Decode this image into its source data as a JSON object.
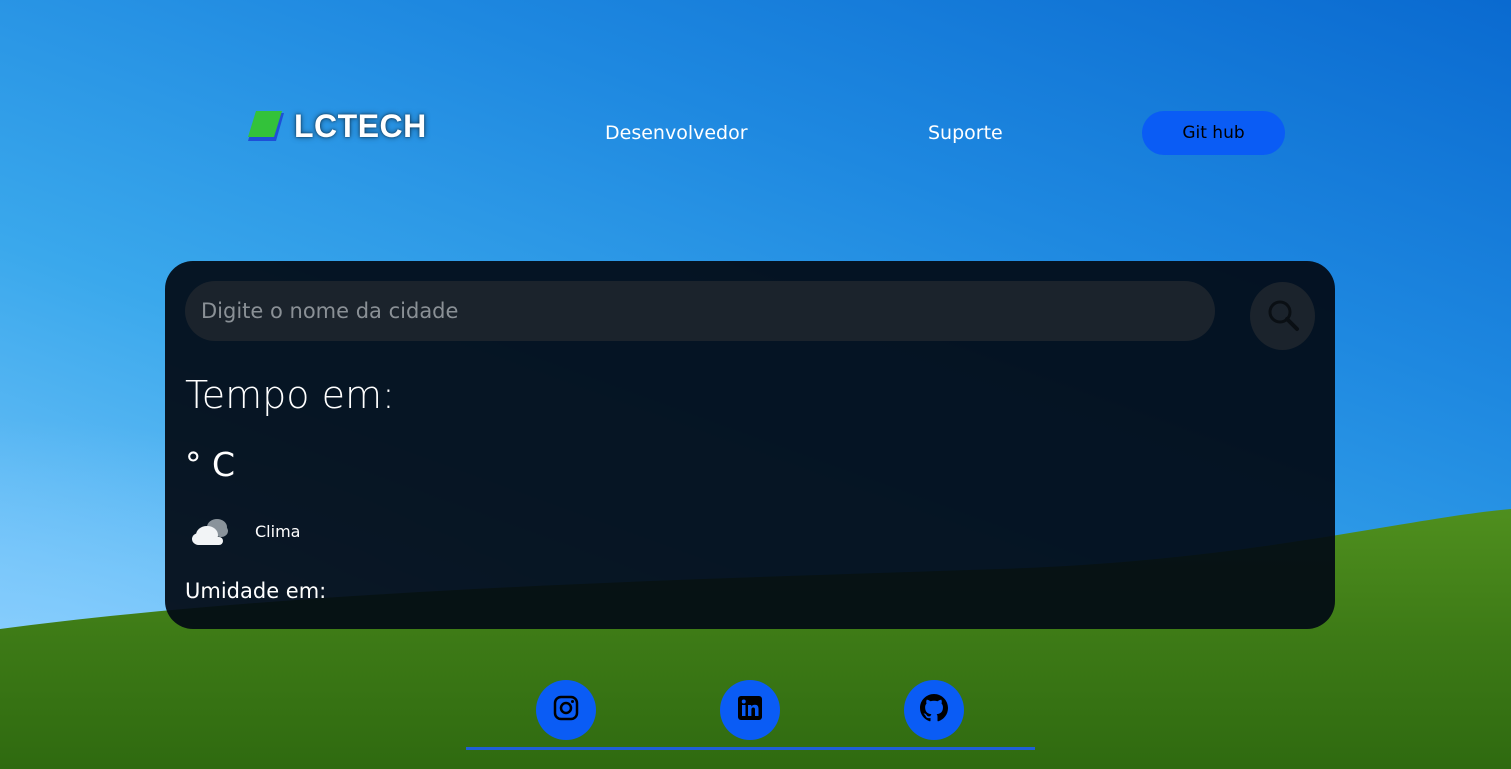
{
  "header": {
    "logo_text": "LCTECH",
    "nav": {
      "developer": "Desenvolvedor",
      "support": "Suporte"
    },
    "github_button": "Git hub"
  },
  "weather": {
    "search": {
      "placeholder": "Digite o nome da cidade",
      "value": ""
    },
    "city_title": "Tempo em:",
    "temperature": "° C",
    "description": "Clima",
    "humidity": "Umidade em:"
  },
  "footer": {
    "icons": [
      "instagram-icon",
      "linkedin-icon",
      "github-icon"
    ]
  },
  "colors": {
    "accent": "#0a5cf5",
    "card": "#020a14",
    "input": "#1b232c"
  }
}
